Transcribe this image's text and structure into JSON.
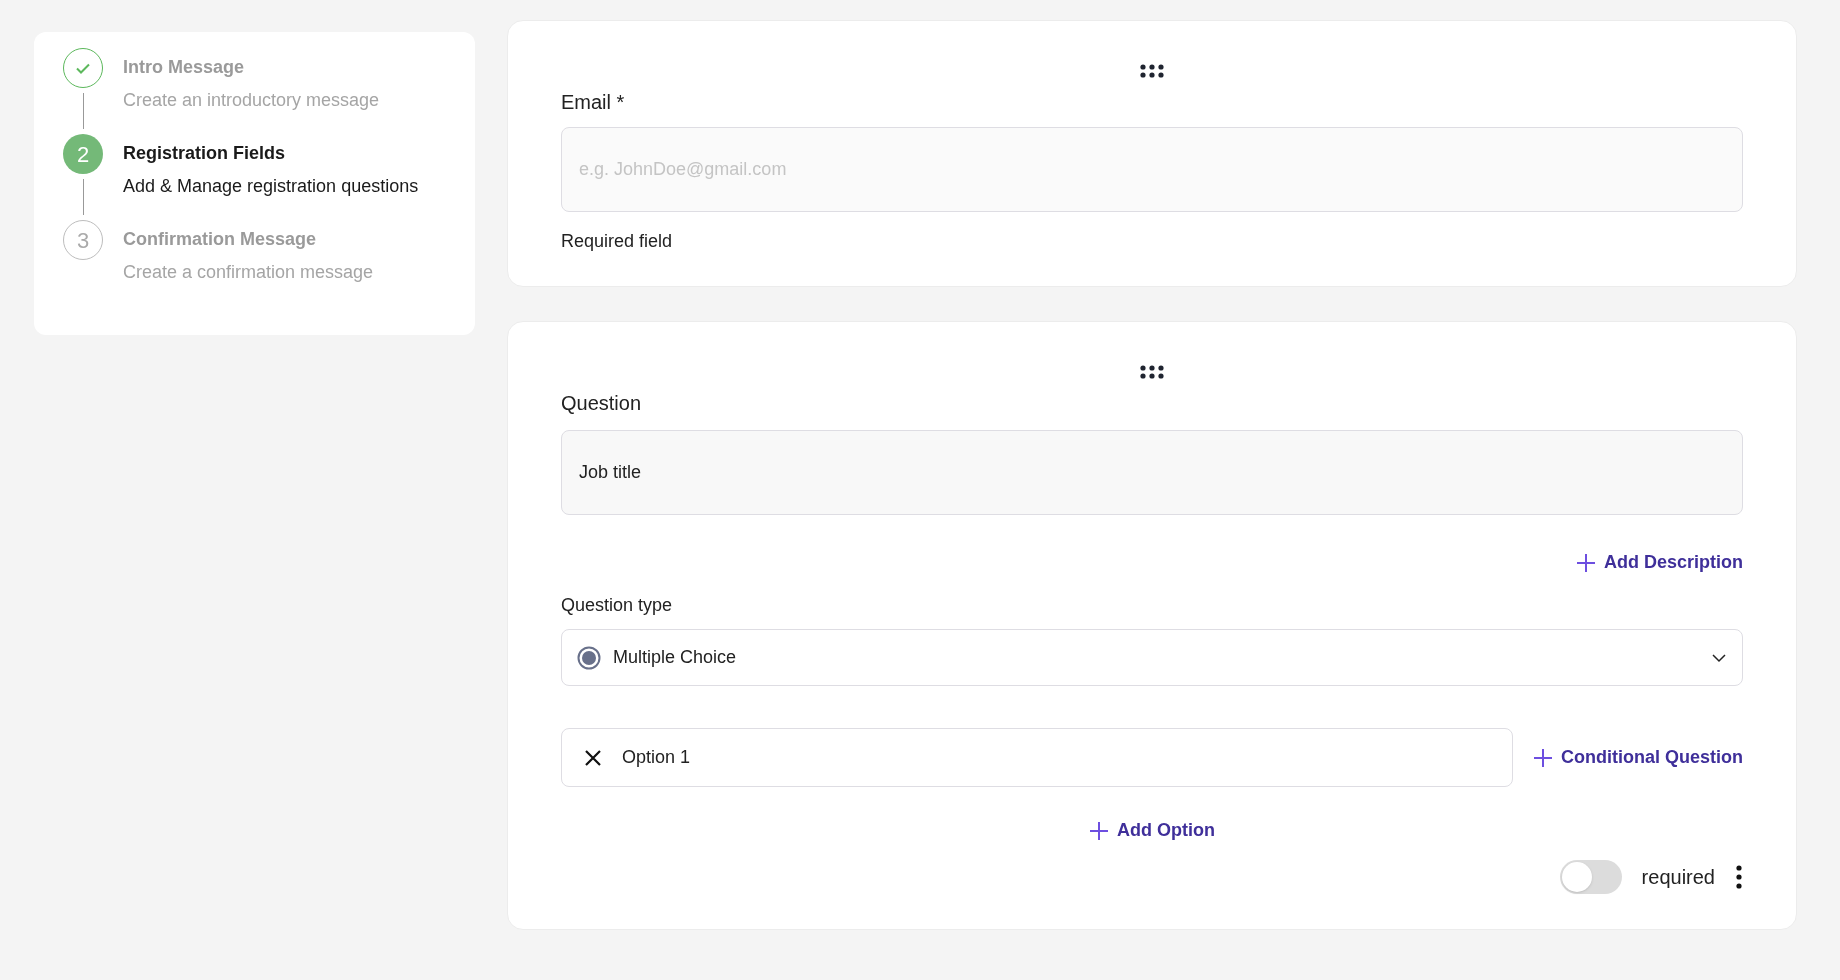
{
  "steps": [
    {
      "title": "Intro Message",
      "subtitle": "Create an introductory message",
      "kind": "done"
    },
    {
      "number": "2",
      "title": "Registration Fields",
      "subtitle": "Add & Manage registration questions",
      "kind": "current"
    },
    {
      "number": "3",
      "title": "Confirmation Message",
      "subtitle": "Create a confirmation message",
      "kind": "upcoming"
    }
  ],
  "email_card": {
    "label": "Email *",
    "placeholder": "e.g. JohnDoe@gmail.com",
    "note": "Required field"
  },
  "question_card": {
    "label": "Question",
    "value": "Job title",
    "add_description": "Add Description",
    "type_label": "Question type",
    "type_value": "Multiple Choice",
    "options": [
      {
        "value": "Option 1"
      }
    ],
    "conditional": "Conditional Question",
    "add_option": "Add Option",
    "required_label": "required",
    "required_on": false
  }
}
